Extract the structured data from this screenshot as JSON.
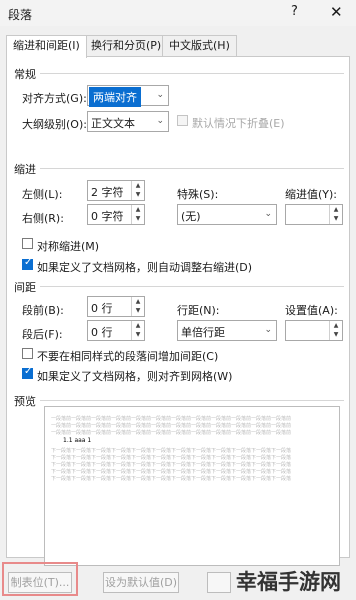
{
  "window": {
    "title": "段落",
    "help_label": "?",
    "close_label": "✕"
  },
  "tabs": [
    {
      "label": "缩进和间距(I)",
      "active": true
    },
    {
      "label": "换行和分页(P)",
      "active": false
    },
    {
      "label": "中文版式(H)",
      "active": false
    }
  ],
  "general": {
    "heading": "常规",
    "alignment": {
      "label": "对齐方式(G):",
      "value": "两端对齐"
    },
    "outline": {
      "label": "大纲级别(O):",
      "value": "正文文本"
    },
    "collapse": {
      "label": "默认情况下折叠(E)",
      "checked": false
    }
  },
  "indent": {
    "heading": "缩进",
    "left": {
      "label": "左侧(L):",
      "value": "2 字符"
    },
    "right": {
      "label": "右侧(R):",
      "value": "0 字符"
    },
    "special": {
      "label": "特殊(S):",
      "value": "(无)"
    },
    "indent_by": {
      "label": "缩进值(Y):",
      "value": ""
    },
    "mirror": {
      "label": "对称缩进(M)",
      "checked": false
    },
    "auto_adjust": {
      "label": "如果定义了文档网格，则自动调整右缩进(D)",
      "checked": true
    }
  },
  "spacing": {
    "heading": "间距",
    "before": {
      "label": "段前(B):",
      "value": "0 行"
    },
    "after": {
      "label": "段后(F):",
      "value": "0 行"
    },
    "line_spacing": {
      "label": "行距(N):",
      "value": "单倍行距"
    },
    "at": {
      "label": "设置值(A):",
      "value": ""
    },
    "no_space_same_style": {
      "label": "不要在相同样式的段落间增加间距(C)",
      "checked": false
    },
    "snap_to_grid": {
      "label": "如果定义了文档网格，则对齐到网格(W)",
      "checked": true
    }
  },
  "preview": {
    "heading": "预览",
    "filler_line": "一段落前一段落前一段落前一段落前一段落前一段落前一段落前一段落前一段落前一段落前一段落前一段落前",
    "sample_text": "1.1 aaa 1",
    "after_line": "下一段落下一段落下一段落下一段落下一段落下一段落下一段落下一段落下一段落下一段落下一段落下一段落"
  },
  "footer": {
    "tabs_button": "制表位(T)...",
    "default_button": "设为默认值(D)"
  },
  "watermark": "幸福手游网",
  "colors": {
    "accent": "#0a6ed1",
    "highlight_box": "#e88a8a"
  }
}
